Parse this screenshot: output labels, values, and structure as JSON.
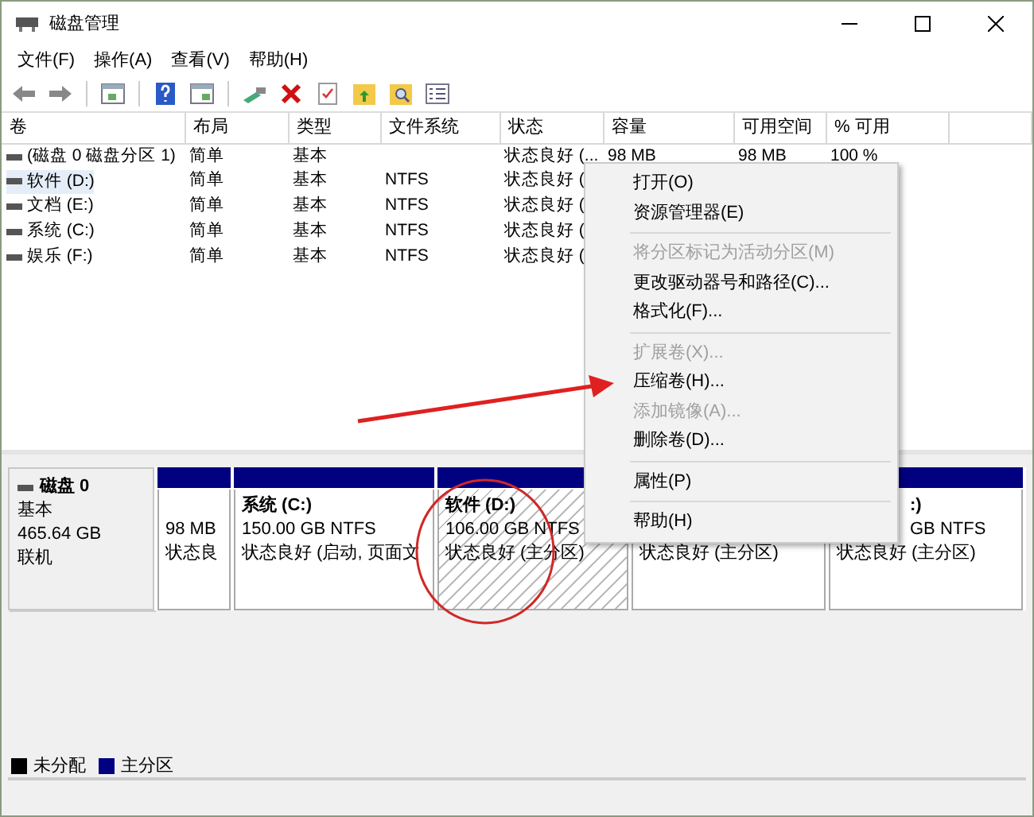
{
  "window": {
    "title": "磁盘管理"
  },
  "menu": [
    "文件(F)",
    "操作(A)",
    "查看(V)",
    "帮助(H)"
  ],
  "volume_table": {
    "columns": [
      "卷",
      "布局",
      "类型",
      "文件系统",
      "状态",
      "容量",
      "可用空间",
      "% 可用"
    ],
    "rows": [
      {
        "volume": "(磁盘 0 磁盘分区 1)",
        "layout": "简单",
        "type": "基本",
        "status": "状态良好 (...",
        "capacity": "98 MB",
        "free": "98 MB",
        "percent_free": "100 %",
        "selected": false
      },
      {
        "volume": "软件 (D:)",
        "layout": "简单",
        "type": "基本",
        "file_system": "NTFS",
        "status": "状态良好 (",
        "selected": true
      },
      {
        "volume": "文档 (E:)",
        "layout": "简单",
        "type": "基本",
        "file_system": "NTFS",
        "status": "状态良好 (",
        "selected": false
      },
      {
        "volume": "系统 (C:)",
        "layout": "简单",
        "type": "基本",
        "file_system": "NTFS",
        "status": "状态良好 (",
        "selected": false
      },
      {
        "volume": "娱乐 (F:)",
        "layout": "简单",
        "type": "基本",
        "file_system": "NTFS",
        "status": "状态良好 (",
        "selected": false
      }
    ]
  },
  "disk": {
    "name": "磁盘 0",
    "type": "基本",
    "size": "465.64 GB",
    "state": "联机",
    "partitions": [
      {
        "size": "98 MB",
        "status": "状态良",
        "selected": false
      },
      {
        "name": "系统 (C:)",
        "size": "150.00 GB NTFS",
        "status": "状态良好 (启动, 页面文",
        "selected": false
      },
      {
        "name": "软件 (D:)",
        "size": "106.00 GB NTFS",
        "status": "状态良好 (主分区)",
        "selected": true
      },
      {
        "status": "状态良好 (主分区)",
        "selected": false
      },
      {
        "name": ":)",
        "size": "GB NTFS",
        "status": "状态良好 (主分区)",
        "selected": false,
        "covered": true
      }
    ]
  },
  "legend": [
    {
      "label": "未分配",
      "color": "#000000"
    },
    {
      "label": "主分区",
      "color": "#000080"
    }
  ],
  "context_menu": [
    {
      "kind": "item",
      "label": "打开(O)",
      "disabled": false
    },
    {
      "kind": "item",
      "label": "资源管理器(E)",
      "disabled": false
    },
    {
      "kind": "separator"
    },
    {
      "kind": "item",
      "label": "将分区标记为活动分区(M)",
      "disabled": true
    },
    {
      "kind": "item",
      "label": "更改驱动器号和路径(C)...",
      "disabled": false
    },
    {
      "kind": "item",
      "label": "格式化(F)...",
      "disabled": false
    },
    {
      "kind": "separator"
    },
    {
      "kind": "item",
      "label": "扩展卷(X)...",
      "disabled": true
    },
    {
      "kind": "item",
      "label": "压缩卷(H)...",
      "disabled": false
    },
    {
      "kind": "item",
      "label": "添加镜像(A)...",
      "disabled": true
    },
    {
      "kind": "item",
      "label": "删除卷(D)...",
      "disabled": false
    },
    {
      "kind": "separator"
    },
    {
      "kind": "item",
      "label": "属性(P)",
      "disabled": false
    },
    {
      "kind": "separator"
    },
    {
      "kind": "item",
      "label": "帮助(H)",
      "disabled": false
    }
  ]
}
